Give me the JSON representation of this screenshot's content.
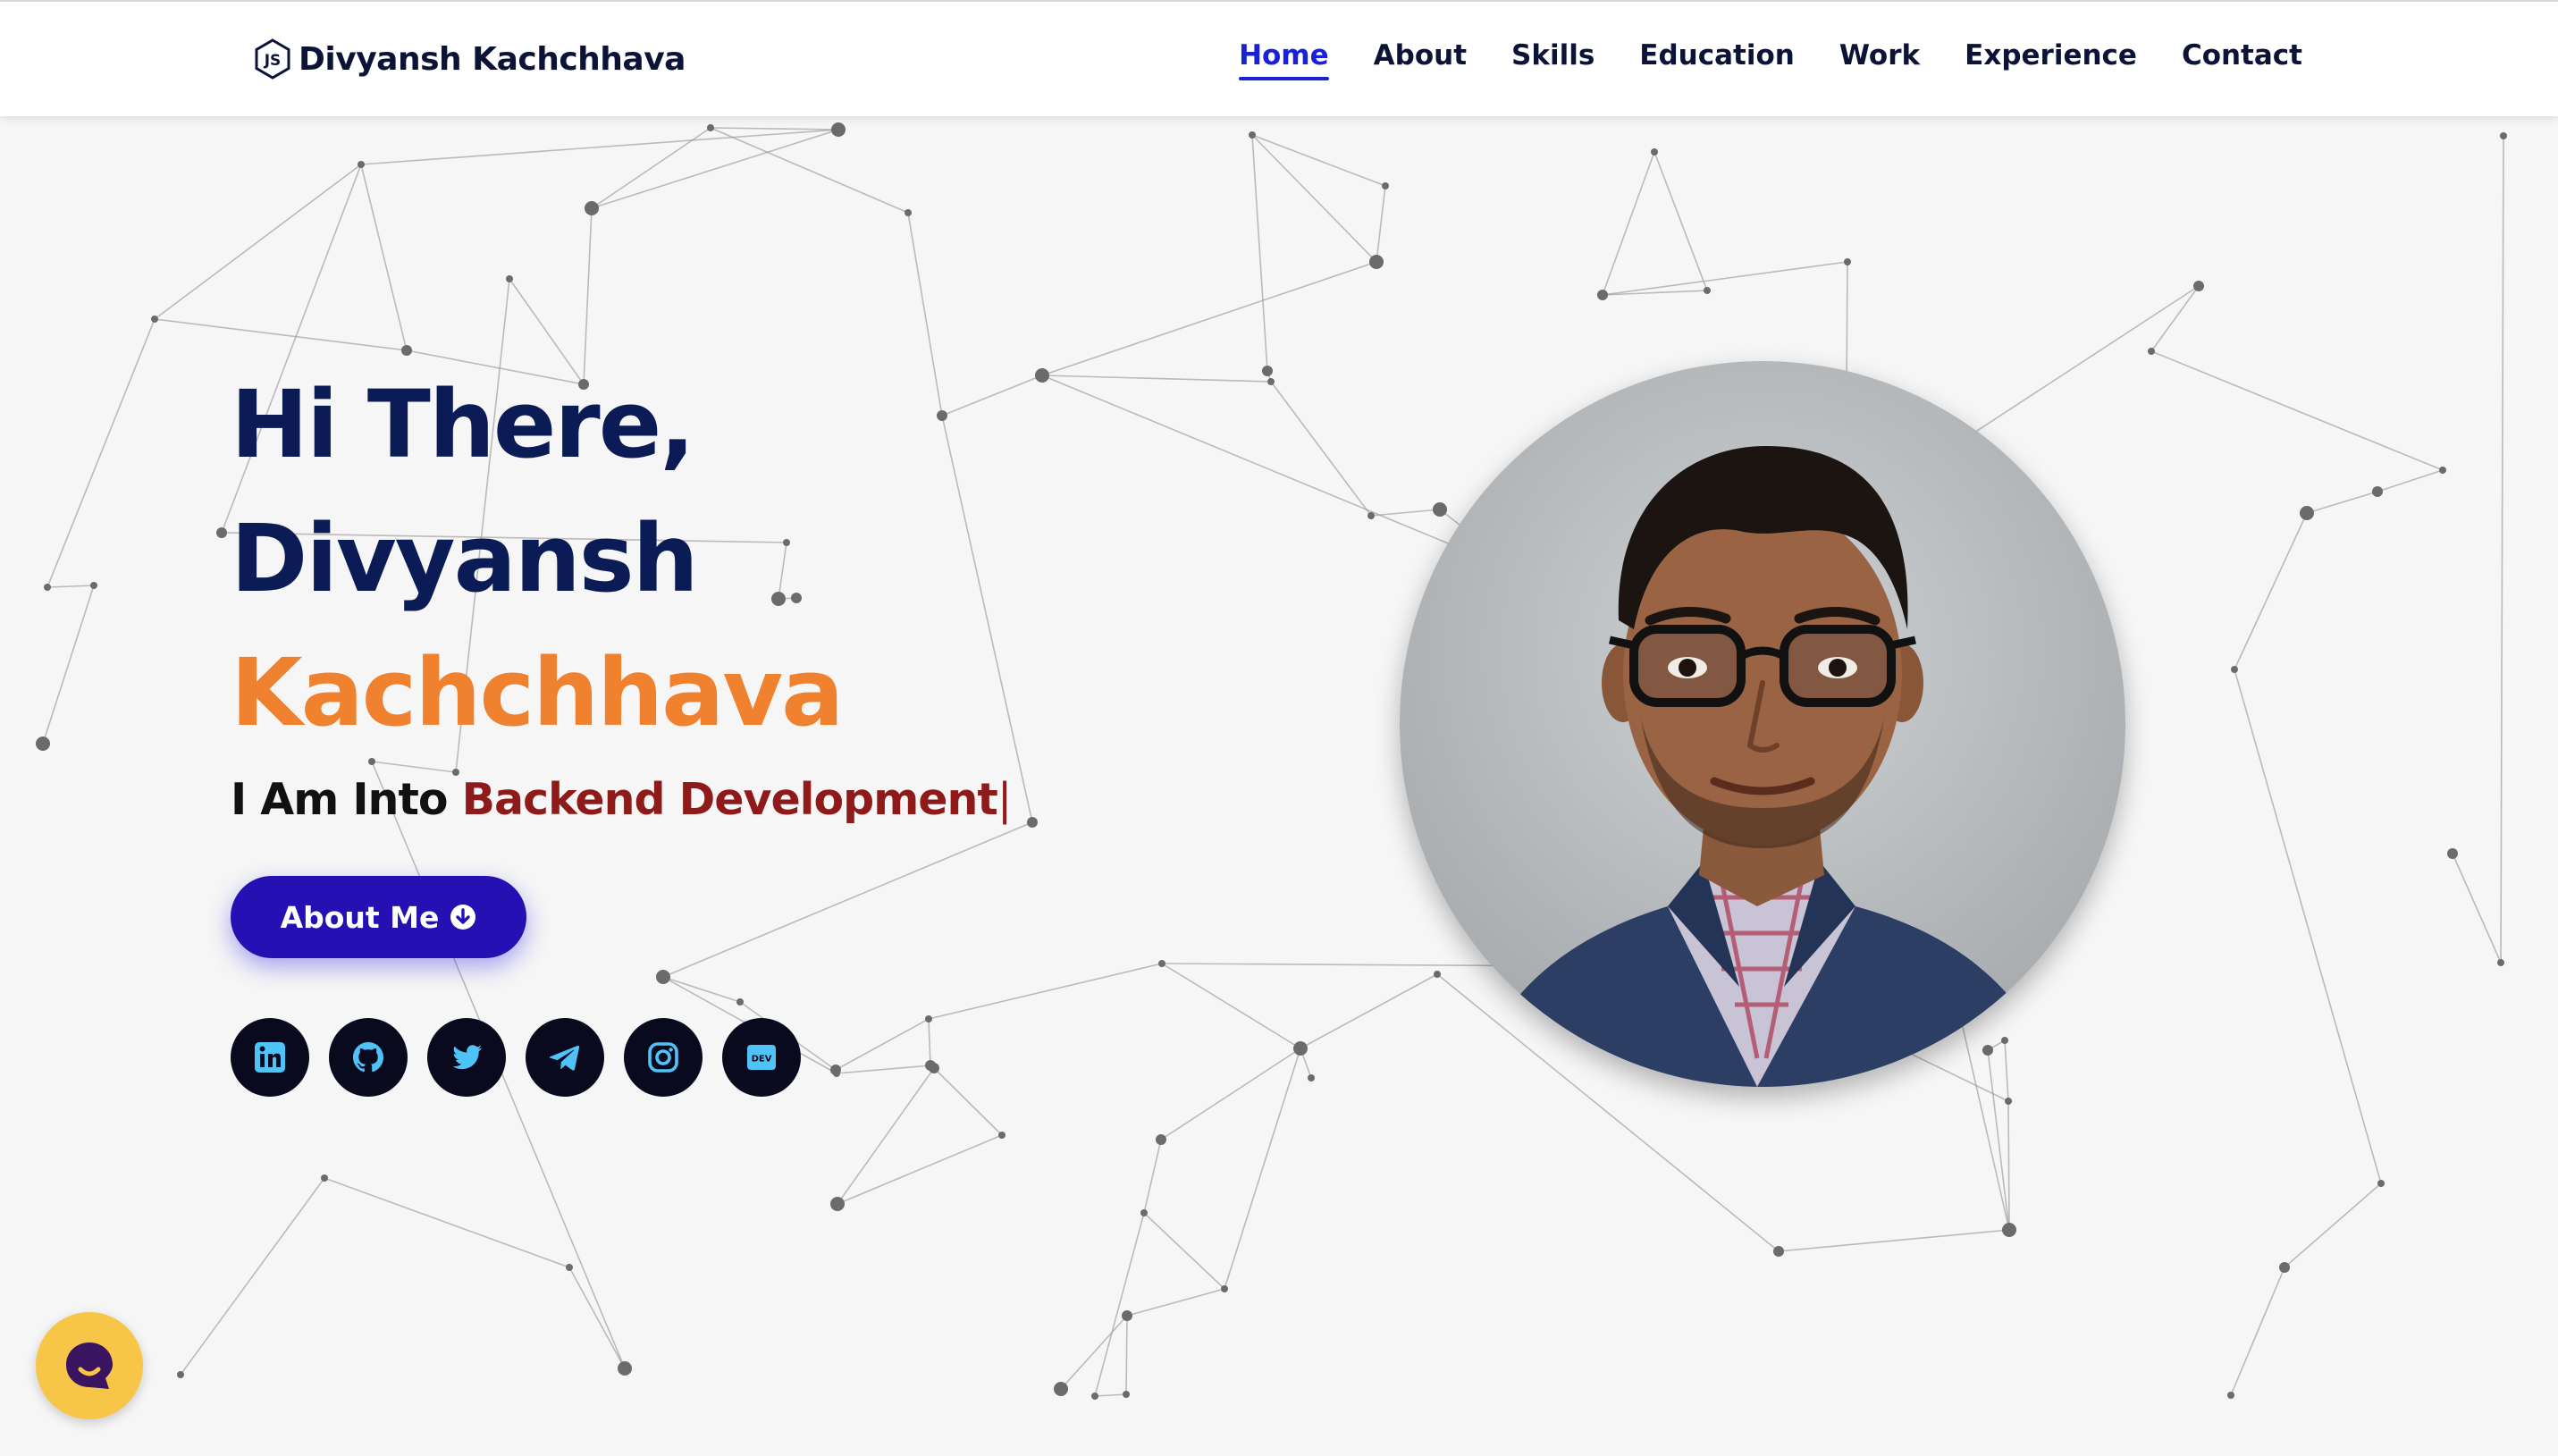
{
  "brand": {
    "name": "Divyansh Kachchhava",
    "logo_icon": "nodejs-logo-icon"
  },
  "nav": {
    "items": [
      {
        "label": "Home",
        "active": true
      },
      {
        "label": "About",
        "active": false
      },
      {
        "label": "Skills",
        "active": false
      },
      {
        "label": "Education",
        "active": false
      },
      {
        "label": "Work",
        "active": false
      },
      {
        "label": "Experience",
        "active": false
      },
      {
        "label": "Contact",
        "active": false
      }
    ],
    "active_color": "#1a22d6"
  },
  "hero": {
    "greeting": "Hi There,",
    "first_name": "Divyansh",
    "last_name": "Kachchhava",
    "subtitle_prefix": "I Am Into",
    "subtitle_typed": "Backend Development",
    "cursor": "|",
    "name_color": "#0b1b55",
    "accent_color": "#f0812f",
    "typed_color": "#8e1a1a"
  },
  "about_button": {
    "label": "About Me",
    "icon": "arrow-circle-down-icon",
    "color": "#2410b3"
  },
  "socials": [
    {
      "name": "linkedin",
      "icon": "linkedin-icon"
    },
    {
      "name": "github",
      "icon": "github-icon"
    },
    {
      "name": "twitter",
      "icon": "twitter-icon"
    },
    {
      "name": "telegram",
      "icon": "telegram-icon"
    },
    {
      "name": "instagram",
      "icon": "instagram-icon"
    },
    {
      "name": "dev",
      "icon": "dev-to-icon",
      "text": "DEV"
    }
  ],
  "social_icon_color": "#4fc3f7",
  "portrait": {
    "icon": "profile-photo"
  },
  "chat": {
    "icon": "chat-bubble-icon",
    "color": "#f7c548"
  }
}
